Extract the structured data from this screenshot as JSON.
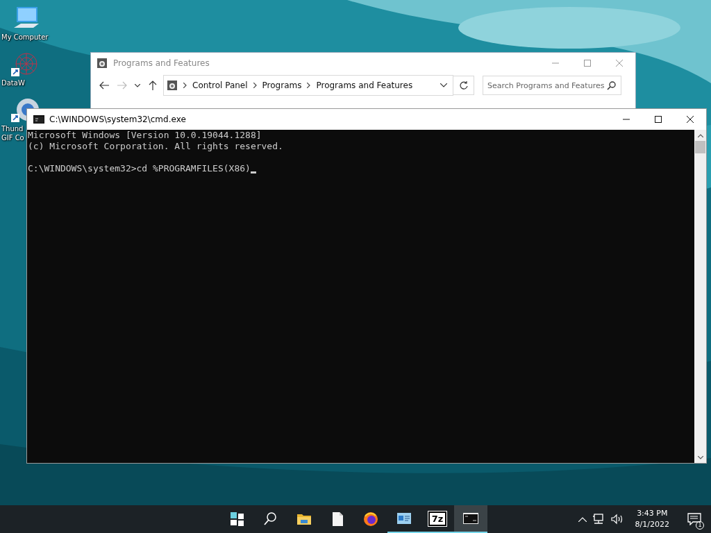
{
  "desktop_icons": [
    {
      "kind": "computer",
      "label": "My Computer",
      "shortcut": false
    },
    {
      "kind": "network",
      "label": "DataW",
      "shortcut": true
    },
    {
      "kind": "disc",
      "label": "Thund\nGIF Co",
      "shortcut": true
    }
  ],
  "explorer_window": {
    "title": "Programs and Features",
    "breadcrumb": [
      "Control Panel",
      "Programs",
      "Programs and Features"
    ],
    "search": {
      "placeholder": "Search Programs and Features"
    }
  },
  "cmd_window": {
    "title": "C:\\WINDOWS\\system32\\cmd.exe",
    "lines": [
      "Microsoft Windows [Version 10.0.19044.1288]",
      "(c) Microsoft Corporation. All rights reserved."
    ],
    "prompt": "C:\\WINDOWS\\system32>cd %PROGRAMFILES(X86)"
  },
  "taskbar": {
    "items": [
      {
        "kind": "start",
        "running": false,
        "selected": false
      },
      {
        "kind": "search",
        "running": false,
        "selected": false
      },
      {
        "kind": "folder",
        "running": false,
        "selected": false
      },
      {
        "kind": "file",
        "running": false,
        "selected": false
      },
      {
        "kind": "browser",
        "running": false,
        "selected": false
      },
      {
        "kind": "control-panel",
        "running": true,
        "selected": false
      },
      {
        "kind": "archiver",
        "label": "7z",
        "running": true,
        "selected": false
      },
      {
        "kind": "console",
        "running": true,
        "selected": true
      }
    ],
    "time": "3:43 PM",
    "date": "8/1/2022",
    "notification_count": "1"
  }
}
